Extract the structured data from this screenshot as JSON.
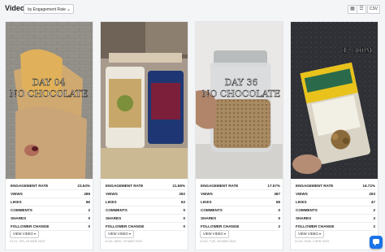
{
  "header": {
    "title": "Videos",
    "sort_label": "by Engagement Rate",
    "csv_label": "CSV"
  },
  "cards": [
    {
      "overlay_line1": "DAY 04",
      "overlay_line2": "NO CHOCOLATE",
      "stats": [
        {
          "label": "ENGAGEMENT RATE",
          "value": "23.53%"
        },
        {
          "label": "VIEWS",
          "value": "289"
        },
        {
          "label": "LIKES",
          "value": "66"
        },
        {
          "label": "COMMENTS",
          "value": "2"
        },
        {
          "label": "SHARES",
          "value": "0"
        },
        {
          "label": "FOLLOWER CHANGE",
          "value": "0"
        }
      ],
      "view_label": "VIEW VIDEO",
      "date": "21:21, FRI, 25 MAR 2023"
    },
    {
      "overlay_line1": "",
      "overlay_line2": "",
      "stats": [
        {
          "label": "ENGAGEMENT RATE",
          "value": "21.58%"
        },
        {
          "label": "VIEWS",
          "value": "292"
        },
        {
          "label": "LIKES",
          "value": "63"
        },
        {
          "label": "COMMENTS",
          "value": "0"
        },
        {
          "label": "SHARES",
          "value": "0"
        },
        {
          "label": "FOLLOWER CHANGE",
          "value": "0"
        }
      ],
      "view_label": "VIEW VIDEO",
      "date": "21:46, WED, 29 MAR 2023"
    },
    {
      "overlay_line1": "DAY 36",
      "overlay_line2": "NO CHOCOLATE",
      "stats": [
        {
          "label": "ENGAGEMENT RATE",
          "value": "17.57%"
        },
        {
          "label": "VIEWS",
          "value": "387"
        },
        {
          "label": "LIKES",
          "value": "68"
        },
        {
          "label": "COMMENTS",
          "value": "0"
        },
        {
          "label": "SHARES",
          "value": "0"
        },
        {
          "label": "FOLLOWER CHANGE",
          "value": "2"
        }
      ],
      "view_label": "VIEW VIDEO",
      "date": "21:02, TUE, 28 MAR 2023"
    },
    {
      "overlay_line1": "12:30PM",
      "overlay_line2": "",
      "stats": [
        {
          "label": "ENGAGEMENT RATE",
          "value": "16.72%"
        },
        {
          "label": "VIEWS",
          "value": "293"
        },
        {
          "label": "LIKES",
          "value": "47"
        },
        {
          "label": "COMMENTS",
          "value": "2"
        },
        {
          "label": "SHARES",
          "value": "3"
        },
        {
          "label": "FOLLOWER CHANGE",
          "value": "2"
        }
      ],
      "view_label": "VIEW VIDEO",
      "date": "21:49, SUN, 2 APR 2023"
    }
  ],
  "icons": [
    "chevron-down-icon",
    "grid-view-icon",
    "list-view-icon",
    "chat-icon"
  ],
  "colors": {
    "background": "#f4f5f6",
    "accent": "#1a73e8"
  }
}
